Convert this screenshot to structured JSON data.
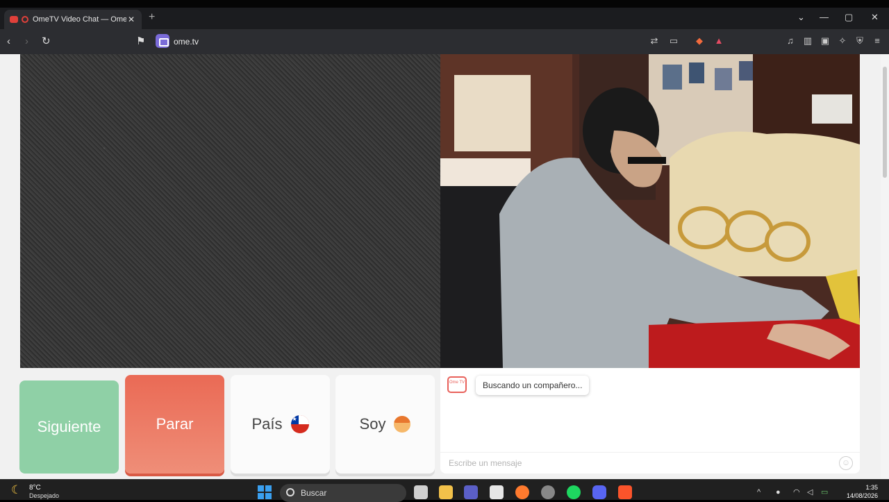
{
  "browser": {
    "tab_title": "OmeTV Video Chat — Omegl",
    "tab_close": "✕",
    "new_tab": "+",
    "url": "ome.tv"
  },
  "page": {
    "buttons": {
      "next": "Siguiente",
      "stop": "Parar",
      "country": "País",
      "iam": "Soy"
    },
    "chat": {
      "logo_text": "Ome TV",
      "status": "Buscando un compañero...",
      "input_placeholder": "Escribe un mensaje"
    }
  },
  "taskbar": {
    "weather_temp": "8°C",
    "weather_desc": "Despejado",
    "search_label": "Buscar",
    "time": "1:35",
    "date": "14/08/2026"
  },
  "colors": {
    "next": "#8fd0a6",
    "stop": "#ea6a55",
    "accent_purple": "#7a6bd8"
  }
}
